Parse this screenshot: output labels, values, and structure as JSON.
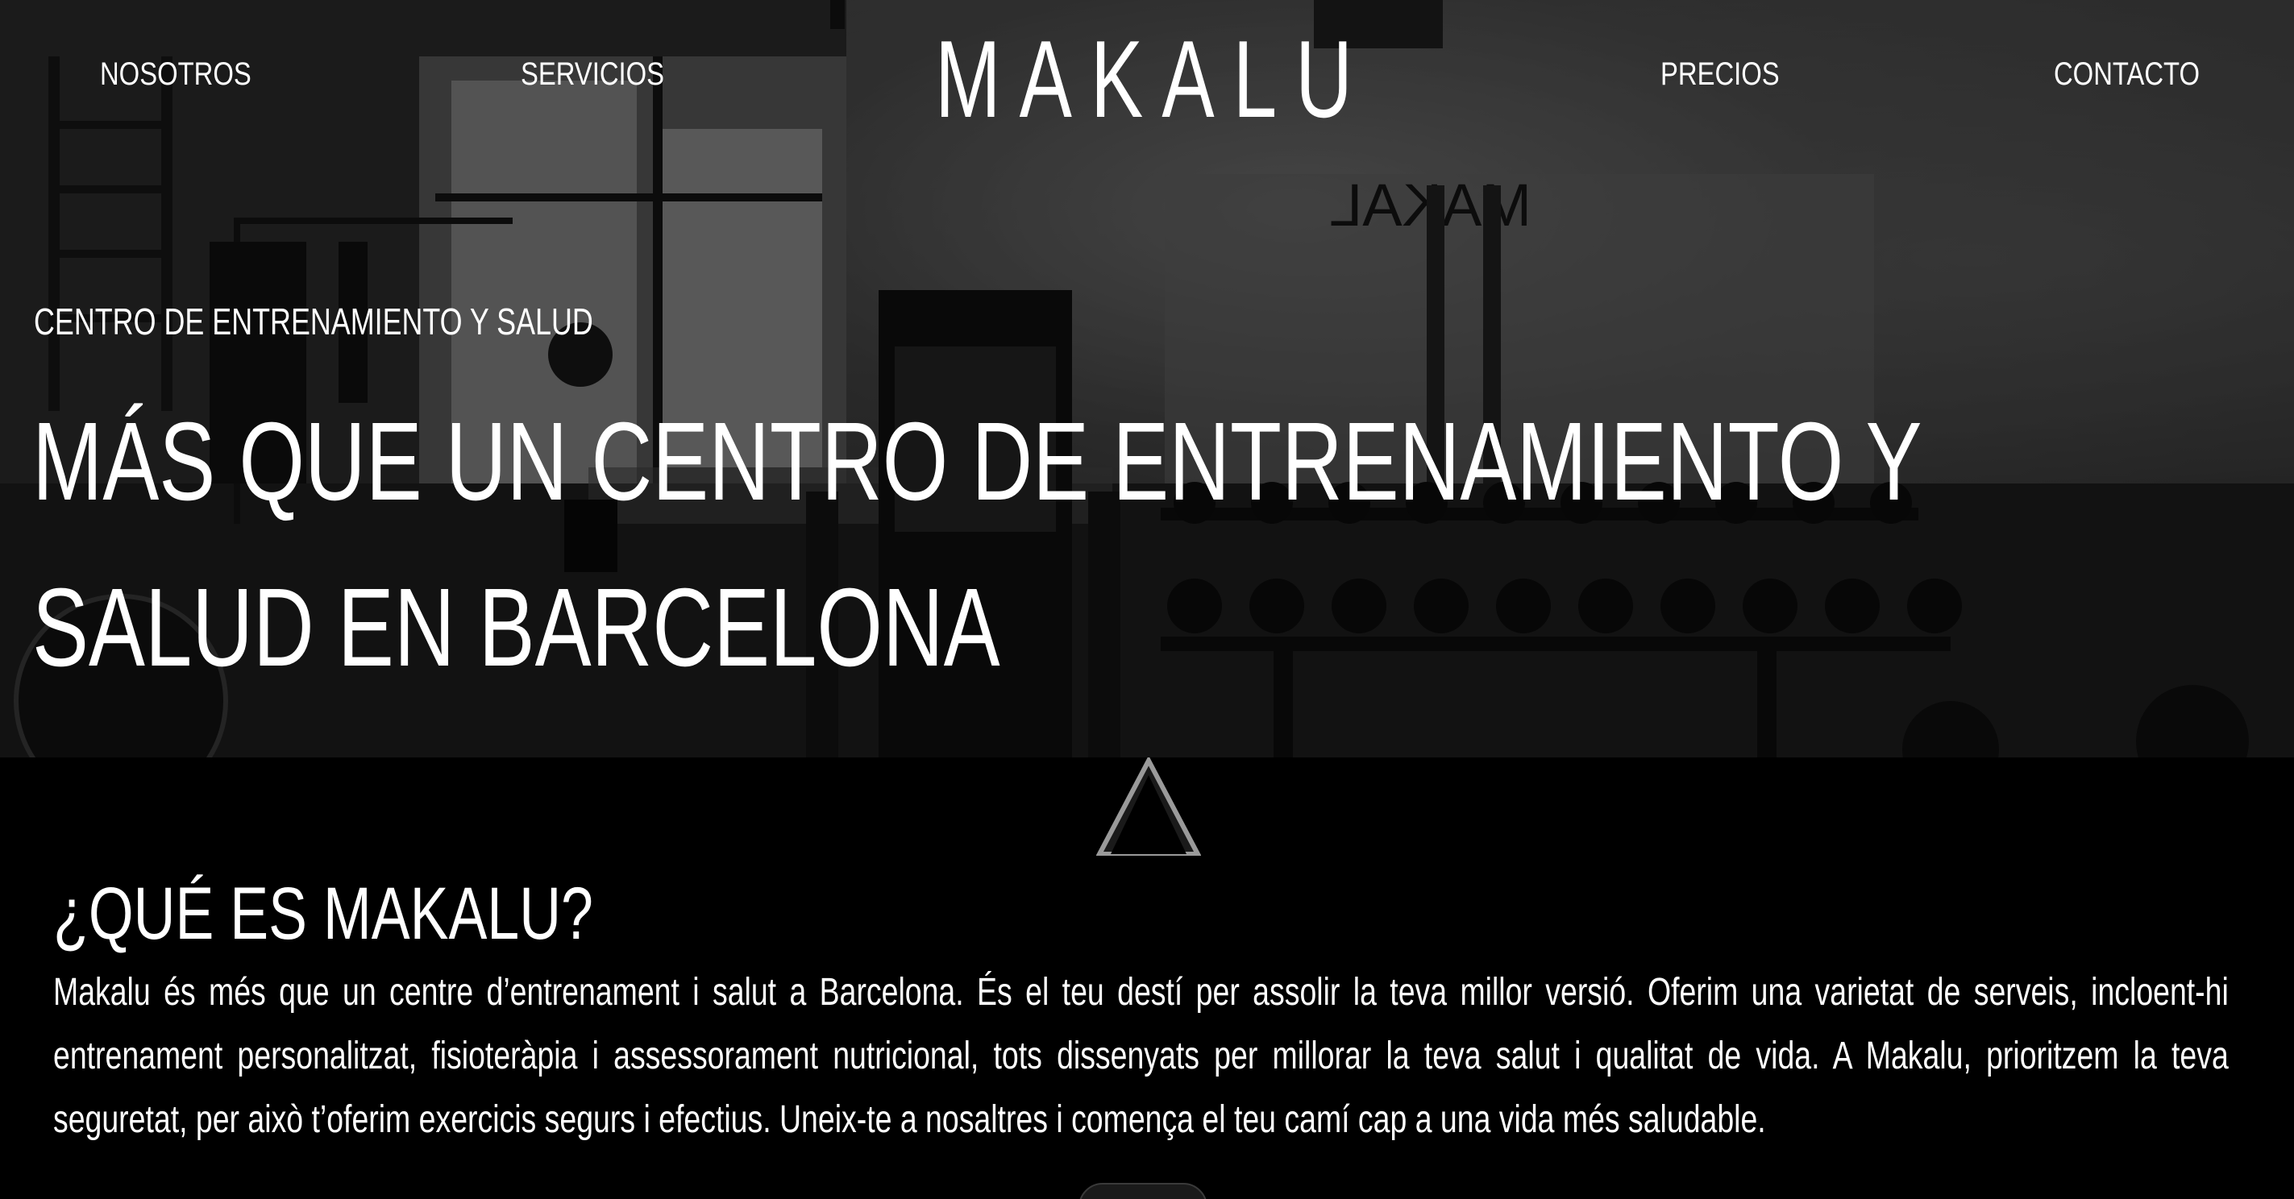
{
  "nav": {
    "left": [
      {
        "label": "NOSOTROS"
      },
      {
        "label": "SERVICIOS"
      }
    ],
    "logo": "MAKALU",
    "right": [
      {
        "label": "PRECIOS"
      },
      {
        "label": "CONTACTO"
      }
    ]
  },
  "hero": {
    "kicker": "CENTRO DE ENTRENAMIENTO Y SALUD",
    "headline": "MÁS QUE UN CENTRO DE ENTRENAMIENTO Y SALUD EN BARCELONA",
    "mirror_text": "MAKAL"
  },
  "about": {
    "title": "¿QUÉ ES MAKALU?",
    "body": "Makalu és més que un centre d’entrenament i salut a Barcelona. És el teu destí per assolir la teva millor versió. Oferim una varietat de serveis, incloent-hi entrenament personalitzat, fisioteràpia i assessorament nutricional, tots dissenyats per millorar la teva salut i qualitat de vida. A Makalu, prioritzem la teva seguretat, per això t’oferim exercicis segurs i efectius. Uneix-te a nosaltres i comença el teu camí cap a una vida més saludable."
  },
  "colors": {
    "background": "#000000",
    "text": "#ffffff"
  },
  "icons": {
    "divider": "triangle-outline-icon"
  }
}
